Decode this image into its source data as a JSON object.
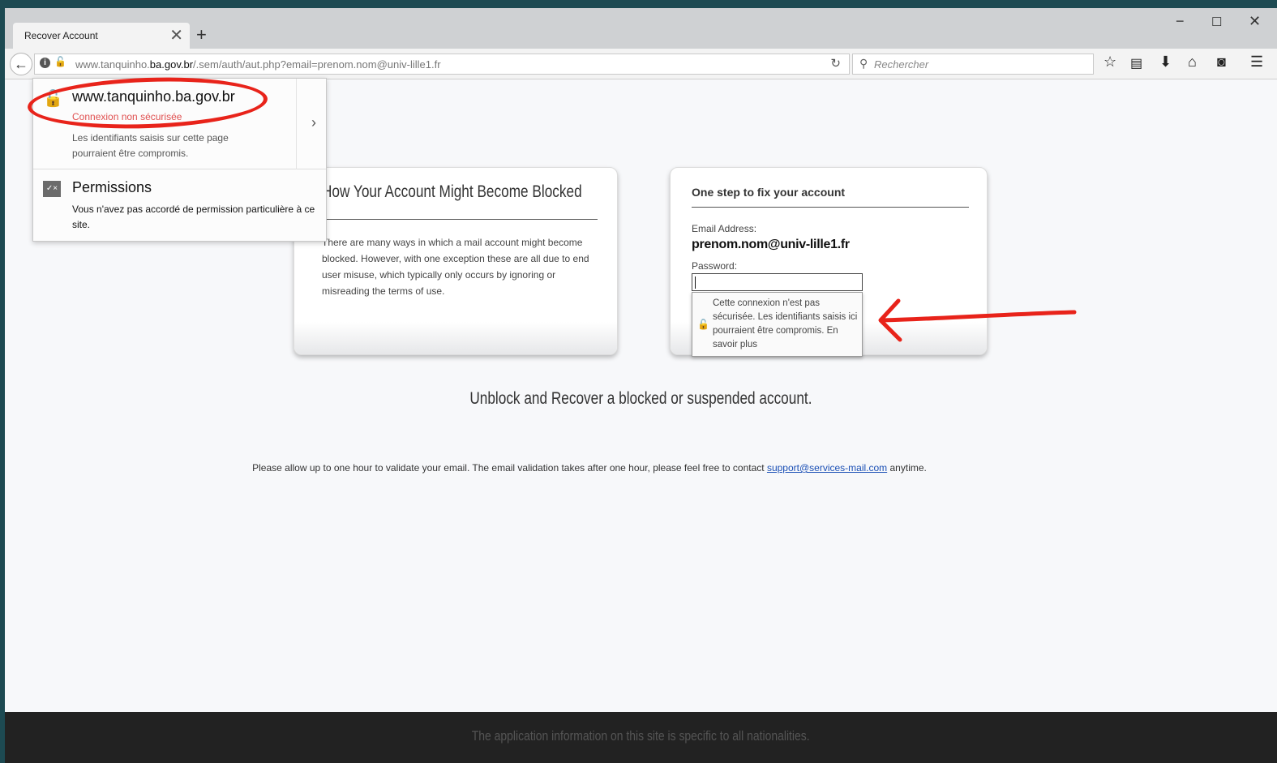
{
  "browser": {
    "tab_title": "Recover Account",
    "tab_close": "✕",
    "new_tab": "+",
    "window_controls": {
      "minimize": "−",
      "maximize": "☐",
      "close": "✕"
    },
    "url_prefix": "www.tanquinho.",
    "url_domain": "ba.gov.br",
    "url_path": "/.sem/auth/aut.php?email=prenom.nom@univ-lille1.fr",
    "search_placeholder": "Rechercher",
    "icons": [
      "star-icon",
      "reading-list-icon",
      "download-icon",
      "home-icon",
      "pocket-icon",
      "menu-icon"
    ]
  },
  "identity_popup": {
    "host": "www.tanquinho.ba.gov.br",
    "insecure_label": "Connexion non sécurisée",
    "insecure_desc": "Les identifiants saisis sur cette page pourraient être compromis.",
    "permissions_title": "Permissions",
    "permissions_desc": "Vous n'avez pas accordé de permission particulière à ce site."
  },
  "panel_left": {
    "heading": "How Your Account Might Become Blocked",
    "body": "There are many ways in which a mail account might become blocked. However, with one exception these are all due to end user misuse, which typically only occurs by ignoring or misreading the terms of use."
  },
  "panel_right": {
    "heading": "One step to fix your account",
    "email_label": "Email Address:",
    "email_value": "prenom.nom@univ-lille1.fr",
    "password_label": "Password:",
    "password_warning": "Cette connexion n'est pas sécurisée. Les identifiants saisis ici pourraient être compromis. En savoir plus"
  },
  "main": {
    "headline": "Unblock and Recover a blocked or suspended account.",
    "note_before": "Please allow up to one hour to validate your email. The email validation takes after one hour, please feel free to contact ",
    "support_link": "support@services-mail.com",
    "note_after": " anytime."
  },
  "footer": {
    "text": "The application information on this site is specific to all nationalities."
  },
  "colors": {
    "annotation_red": "#e8231a",
    "insecure_red": "#e05050",
    "link_blue": "#1a4fb5",
    "footer_bg": "#222222"
  }
}
